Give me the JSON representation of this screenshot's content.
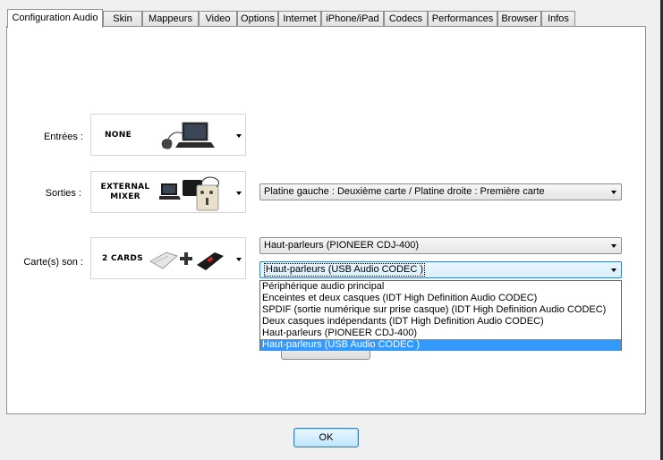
{
  "tabs": [
    {
      "label": "Configuration Audio",
      "active": true
    },
    {
      "label": "Skin"
    },
    {
      "label": "Mappeurs"
    },
    {
      "label": "Video"
    },
    {
      "label": "Options"
    },
    {
      "label": "Internet"
    },
    {
      "label": "iPhone/iPad"
    },
    {
      "label": "Codecs"
    },
    {
      "label": "Performances"
    },
    {
      "label": "Browser"
    },
    {
      "label": "Infos"
    }
  ],
  "rows": {
    "inputs": {
      "label": "Entrées :",
      "device": "NONE"
    },
    "outputs": {
      "label": "Sorties :",
      "device_line1": "EXTERNAL",
      "device_line2": "MIXER",
      "combo": "Platine gauche : Deuxième carte / Platine droite : Première carte"
    },
    "soundcards": {
      "label": "Carte(s) son :",
      "device": "2 CARDS",
      "combo1": "Haut-parleurs (PIONEER CDJ-400)",
      "combo2": "Haut-parleurs (USB Audio CODEC )"
    }
  },
  "dropdown_options": [
    "Périphérique audio principal",
    "Enceintes et deux casques (IDT High Definition Audio CODEC)",
    "SPDIF (sortie numérique sur prise casque) (IDT High Definition Audio CODEC)",
    "Deux casques indépendants (IDT High Definition Audio CODEC)",
    "Haut-parleurs (PIONEER CDJ-400)",
    "Haut-parleurs (USB Audio CODEC )"
  ],
  "dropdown_selected_index": 5,
  "ok_label": "OK"
}
